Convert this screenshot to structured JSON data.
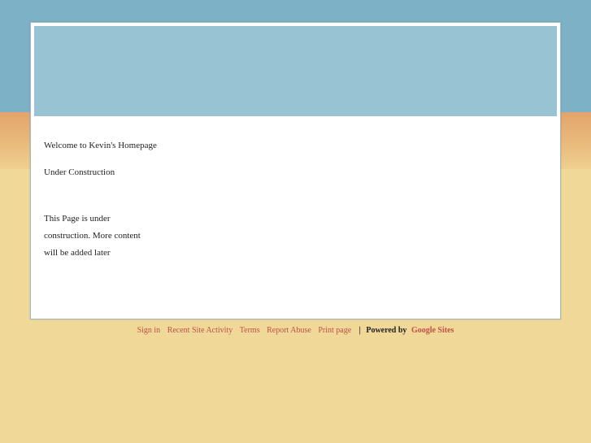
{
  "page": {
    "welcome": "Welcome to Kevin's Homepage",
    "subtitle": "Under Construction",
    "body_text": "This Page is under construction. More content will be added later"
  },
  "footer": {
    "links": [
      "Sign in",
      "Recent Site Activity",
      "Terms",
      "Report Abuse",
      "Print page"
    ],
    "separator": "|",
    "powered_by": "Powered by",
    "brand": "Google Sites"
  },
  "colors": {
    "sky": "#7fb2c6",
    "header_band": "#99c4d4",
    "sand": "#f0d898",
    "link": "#c0504a"
  }
}
